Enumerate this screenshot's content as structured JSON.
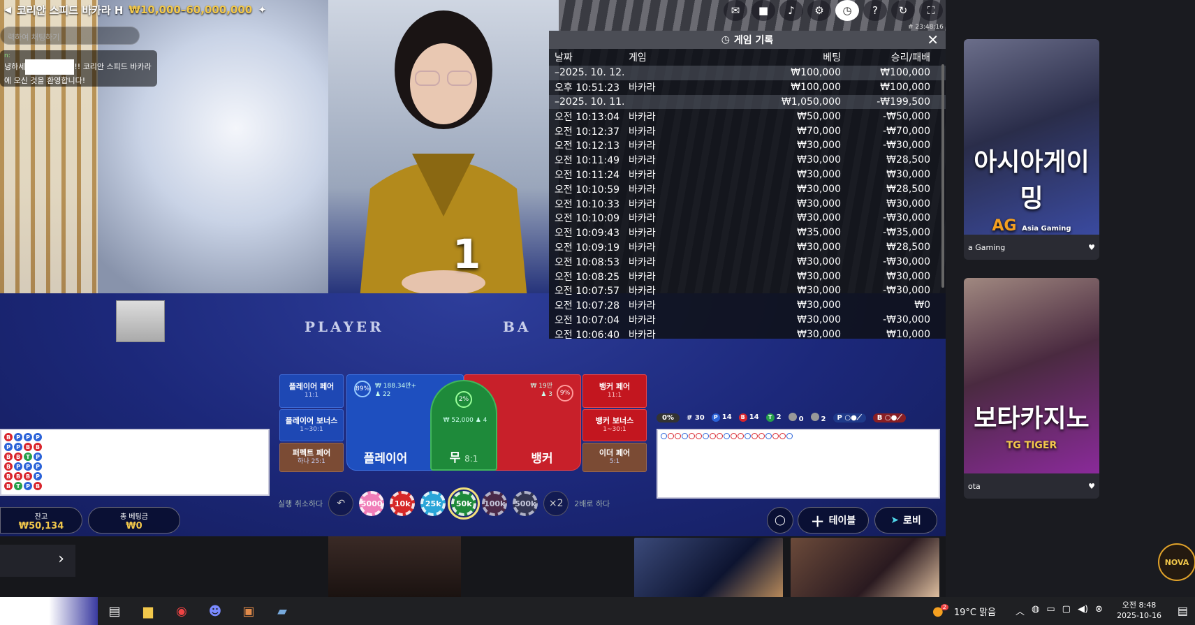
{
  "table": {
    "title": "코리안 스피드 바카라 H",
    "limits": "₩10,000–60,000,000",
    "countdown": "1",
    "player_label": "PLAYER",
    "banker_label": "BA",
    "time_small": "# 23:48:16"
  },
  "chat": {
    "placeholder": "력하여 채팅하기",
    "sender": "n:",
    "message_line1_prefix": "녕하세",
    "message_line1_suffix": "!! 코리안 스피드 바카라",
    "message_line2": "에 오신 것을 환영합니다!"
  },
  "history": {
    "title": "게임 기록",
    "columns": [
      "날짜",
      "게임",
      "베팅",
      "승리/패배"
    ],
    "rows": [
      {
        "type": "date",
        "c1": "–2025. 10. 12.",
        "c2": "",
        "c3": "₩100,000",
        "c4": "₩100,000"
      },
      {
        "type": "row",
        "c1": "오후 10:51:23",
        "c2": "바카라",
        "c3": "₩100,000",
        "c4": "₩100,000"
      },
      {
        "type": "date",
        "c1": "–2025. 10. 11.",
        "c2": "",
        "c3": "₩1,050,000",
        "c4": "-₩199,500"
      },
      {
        "type": "row",
        "c1": "오전 10:13:04",
        "c2": "바카라",
        "c3": "₩50,000",
        "c4": "-₩50,000"
      },
      {
        "type": "row",
        "c1": "오전 10:12:37",
        "c2": "바카라",
        "c3": "₩70,000",
        "c4": "-₩70,000"
      },
      {
        "type": "row",
        "c1": "오전 10:12:13",
        "c2": "바카라",
        "c3": "₩30,000",
        "c4": "-₩30,000"
      },
      {
        "type": "row",
        "c1": "오전 10:11:49",
        "c2": "바카라",
        "c3": "₩30,000",
        "c4": "₩28,500"
      },
      {
        "type": "row",
        "c1": "오전 10:11:24",
        "c2": "바카라",
        "c3": "₩30,000",
        "c4": "₩30,000"
      },
      {
        "type": "row",
        "c1": "오전 10:10:59",
        "c2": "바카라",
        "c3": "₩30,000",
        "c4": "₩28,500"
      },
      {
        "type": "row",
        "c1": "오전 10:10:33",
        "c2": "바카라",
        "c3": "₩30,000",
        "c4": "₩30,000"
      },
      {
        "type": "row",
        "c1": "오전 10:10:09",
        "c2": "바카라",
        "c3": "₩30,000",
        "c4": "-₩30,000"
      },
      {
        "type": "row",
        "c1": "오전 10:09:43",
        "c2": "바카라",
        "c3": "₩35,000",
        "c4": "-₩35,000"
      },
      {
        "type": "row",
        "c1": "오전 10:09:19",
        "c2": "바카라",
        "c3": "₩30,000",
        "c4": "₩28,500"
      },
      {
        "type": "row",
        "c1": "오전 10:08:53",
        "c2": "바카라",
        "c3": "₩30,000",
        "c4": "-₩30,000"
      },
      {
        "type": "row",
        "c1": "오전 10:08:25",
        "c2": "바카라",
        "c3": "₩30,000",
        "c4": "₩30,000"
      },
      {
        "type": "row",
        "c1": "오전 10:07:57",
        "c2": "바카라",
        "c3": "₩30,000",
        "c4": "-₩30,000"
      },
      {
        "type": "row",
        "c1": "오전 10:07:28",
        "c2": "바카라",
        "c3": "₩30,000",
        "c4": "₩0"
      },
      {
        "type": "row",
        "c1": "오전 10:07:04",
        "c2": "바카라",
        "c3": "₩30,000",
        "c4": "-₩30,000"
      },
      {
        "type": "row",
        "c1": "오전 10:06:40",
        "c2": "바카라",
        "c3": "₩30,000",
        "c4": "₩10,000"
      }
    ]
  },
  "bets": {
    "player_pair": {
      "label": "플레이어 페어",
      "odds": "11:1"
    },
    "player_bonus": {
      "label": "플레이어 보너스",
      "odds": "1~30:1"
    },
    "perfect_pair": {
      "label": "퍼펙트 페어",
      "odds": "하나 25:1"
    },
    "banker_pair": {
      "label": "뱅커 페어",
      "odds": "11:1"
    },
    "banker_bonus": {
      "label": "뱅커 보너스",
      "odds": "1~30:1"
    },
    "either_pair": {
      "label": "이더 페어",
      "odds": "5:1"
    },
    "player": {
      "label": "플레이어",
      "pct": "89%",
      "amount": "₩ 188.34만+",
      "players": "22"
    },
    "tie": {
      "label": "무",
      "odds": "8:1",
      "pct": "2%",
      "amount": "₩ 52,000",
      "players": "4"
    },
    "banker": {
      "label": "뱅커",
      "pct": "9%",
      "amount": "₩ 19만",
      "players": "3"
    }
  },
  "chips": {
    "undo_label": "실행 취소하다",
    "double_label": "2배로 하다",
    "double_icon": "×2",
    "values": [
      "5000",
      "10k",
      "25k",
      "50k",
      "100k",
      "500k"
    ]
  },
  "stats": {
    "pct": "0%",
    "rounds": "# 30",
    "player": "14",
    "banker": "14",
    "tie": "2",
    "pp": "0",
    "bp": "2",
    "p_letter": "P",
    "b_letter": "B",
    "t_letter": "T"
  },
  "footer": {
    "balance_label": "잔고",
    "balance_value": "₩50,134",
    "totalbet_label": "총 베팅금",
    "totalbet_value": "₩0",
    "table_btn": "테이블",
    "lobby_btn": "로비"
  },
  "side": {
    "card1_art": "아시아게이밍",
    "card1_brand": "AG",
    "card1_brand_sub": "Asia Gaming",
    "card1_caption": "a Gaming",
    "card2_art": "보타카지노",
    "card2_brand": "TG TIGER",
    "card2_caption": "ota",
    "nova": "NOVA"
  },
  "taskbar": {
    "weather": "19°C 맑음",
    "time": "오전 8:48",
    "date": "2025-10-16",
    "badge": "2"
  },
  "colors": {
    "accent_gold": "#f2c84b",
    "player_blue": "#1e4fbf",
    "banker_red": "#c8202a",
    "tie_green": "#1e8a3a"
  }
}
